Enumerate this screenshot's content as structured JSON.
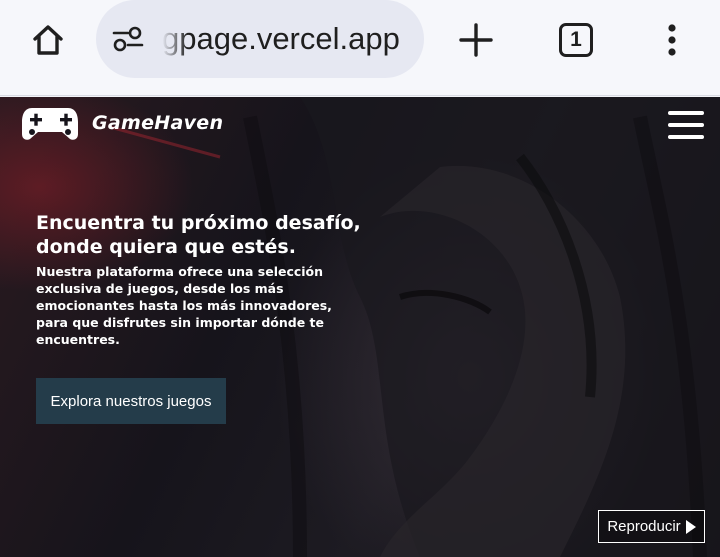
{
  "browser": {
    "url": "gpage.vercel.app",
    "tab_count": "1",
    "icons": [
      "home-icon",
      "site-settings-icon",
      "plus-icon",
      "tab-switcher-icon",
      "more-vert-icon"
    ]
  },
  "site": {
    "brand": "GameHaven",
    "logo_icon": "gamepad-icon",
    "menu_icon": "hamburger-icon"
  },
  "hero": {
    "title_line1": "Encuentra tu próximo desafío,",
    "title_line2": "donde quiera que estés.",
    "description": "Nuestra plataforma ofrece una selección exclusiva de juegos, desde los más emocionantes hasta los más innovadores, para que disfrutes sin importar dónde te encuentres.",
    "cta_label": "Explora nuestros juegos"
  },
  "video": {
    "play_label": "Reproducir",
    "play_icon": "play-icon"
  },
  "colors": {
    "browser_bg": "#f6f7fb",
    "url_pill_bg": "#e6e8f2",
    "cta_bg": "#243c4a",
    "page_bg": "#16141b",
    "text": "#ffffff"
  }
}
